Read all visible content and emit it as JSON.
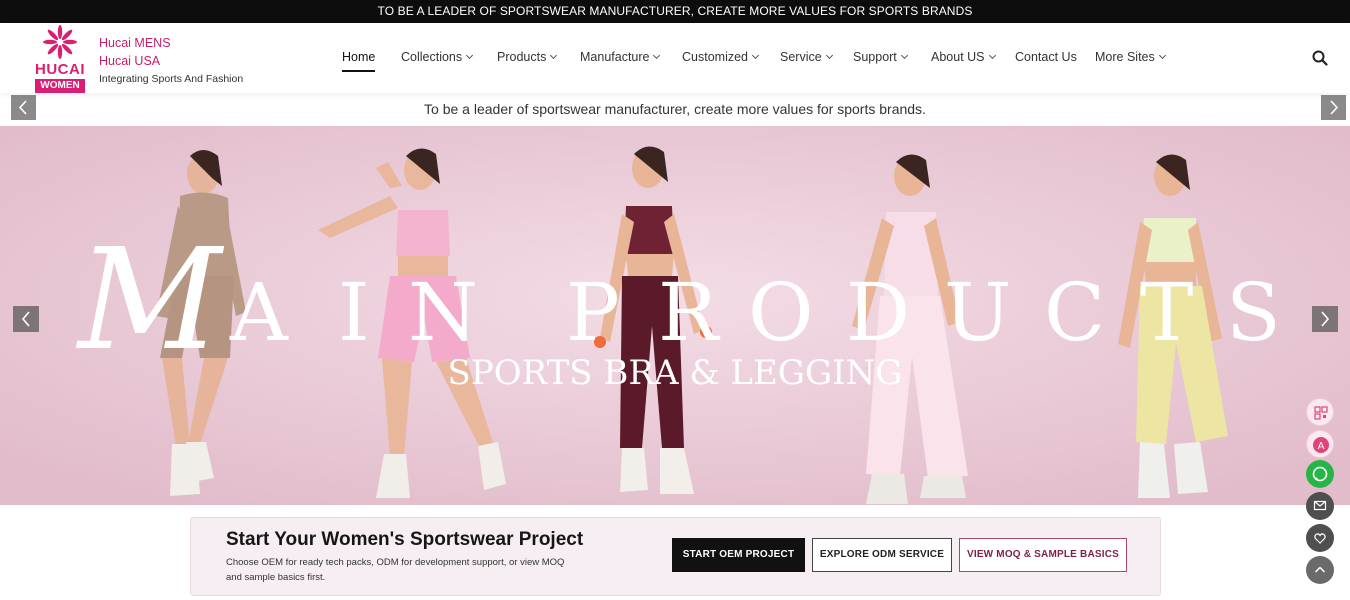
{
  "topbar": {
    "text": "TO BE A LEADER OF SPORTSWEAR MANUFACTURER, CREATE MORE VALUES FOR SPORTS BRANDS"
  },
  "logo": {
    "word": "HUCAI",
    "badge": "WOMEN"
  },
  "brand_links": {
    "mens": "Hucai MENS",
    "usa": "Hucai USA",
    "tagline": "Integrating Sports And Fashion"
  },
  "nav": {
    "items": [
      {
        "label": "Home",
        "dropdown": false,
        "active": true
      },
      {
        "label": "Collections",
        "dropdown": true
      },
      {
        "label": "Products",
        "dropdown": true
      },
      {
        "label": "Manufacture",
        "dropdown": true
      },
      {
        "label": "Customized",
        "dropdown": true
      },
      {
        "label": "Service",
        "dropdown": true
      },
      {
        "label": "Support",
        "dropdown": true
      },
      {
        "label": "About US",
        "dropdown": true
      },
      {
        "label": "Contact Us",
        "dropdown": false
      },
      {
        "label": "More Sites",
        "dropdown": true
      }
    ]
  },
  "ticker": {
    "text": "To be a leader of sportswear manufacturer, create more values for sports brands."
  },
  "hero": {
    "headline": "MAIN PRODUCTS",
    "headline_letters": [
      "A",
      "I",
      "N",
      "P",
      "R",
      "O",
      "D",
      "U",
      "C",
      "T",
      "S"
    ],
    "headline_script_letter": "M",
    "subheadline": "SPORTS BRA & LEGGING"
  },
  "cta": {
    "title": "Start Your Women's Sportswear Project",
    "description": "Choose OEM for ready tech packs, ODM for development support, or view MOQ and sample basics first.",
    "buttons": {
      "oem": "START OEM PROJECT",
      "odm": "EXPLORE ODM SERVICE",
      "moq": "VIEW MOQ & SAMPLE BASICS"
    }
  },
  "side_icons": [
    "qr-code-icon",
    "translate-icon",
    "whatsapp-icon",
    "email-icon",
    "heart-icon",
    "back-to-top-icon"
  ],
  "colors": {
    "brand_pink": "#d81f73",
    "dark": "#111111",
    "whatsapp_green": "#27b547",
    "hero_bg": "#e8c8d5"
  }
}
